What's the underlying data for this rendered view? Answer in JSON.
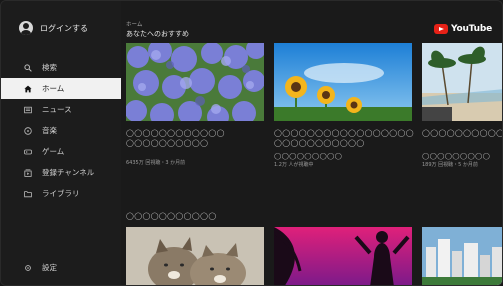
{
  "sidebar": {
    "login_label": "ログインする",
    "items": [
      {
        "label": "検索",
        "icon": "search-icon"
      },
      {
        "label": "ホーム",
        "icon": "home-icon"
      },
      {
        "label": "ニュース",
        "icon": "news-icon"
      },
      {
        "label": "音楽",
        "icon": "music-icon"
      },
      {
        "label": "ゲーム",
        "icon": "game-icon"
      },
      {
        "label": "登録チャンネル",
        "icon": "subscriptions-icon"
      },
      {
        "label": "ライブラリ",
        "icon": "library-icon"
      }
    ],
    "settings_label": "設定"
  },
  "main": {
    "breadcrumb": "ホーム",
    "section_title": "あなたへのおすすめ",
    "brand": "YouTube",
    "row1": [
      {
        "title": "◯◯◯◯◯◯◯◯◯◯◯◯◯◯◯◯◯◯◯◯◯◯",
        "meta": "6435万 回視聴・3 か月前"
      },
      {
        "title": "◯◯◯◯◯◯◯◯◯◯◯◯◯◯◯◯◯◯◯◯◯◯◯◯◯◯◯◯",
        "subtitle": "◯◯◯◯◯◯◯◯◯",
        "meta": "1.2万 人が視聴中"
      },
      {
        "title": "◯◯◯◯◯◯◯◯◯◯",
        "subtitle": "◯◯◯◯◯◯◯◯◯",
        "meta": "189万 回視聴・5 か月前"
      }
    ],
    "row2_title": "◯◯◯◯◯◯◯◯◯◯◯"
  },
  "colors": {
    "accent_red": "#e62117",
    "active_bg": "#f1f1f1",
    "background": "#1a1a1a"
  }
}
